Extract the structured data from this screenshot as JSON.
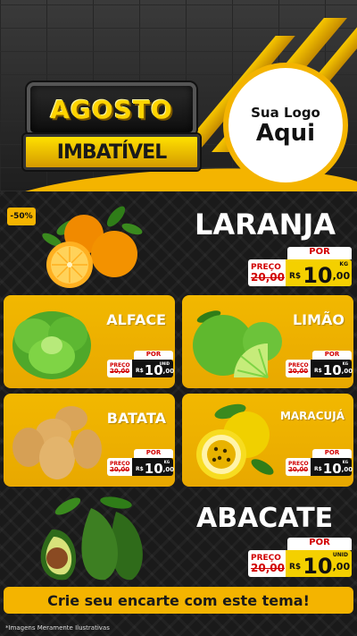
{
  "header": {
    "title_line1": "AGOSTO",
    "title_line2": "IMBATÍVEL",
    "logo_line1": "Sua Logo",
    "logo_line2": "Aqui"
  },
  "discount_badge": "-50%",
  "products": {
    "laranja": {
      "name": "LARANJA",
      "por": "POR",
      "preco_label": "PREÇO",
      "old": "20,00",
      "currency": "R$",
      "int": "10",
      "dec": ",00",
      "unit": "KG",
      "icon": "orange-image"
    },
    "alface": {
      "name": "ALFACE",
      "por": "POR",
      "preco_label": "PREÇO",
      "old": "20,00",
      "currency": "R$",
      "int": "10",
      "dec": ",00",
      "unit": "UNID",
      "icon": "lettuce-image"
    },
    "limao": {
      "name": "LIMÃO",
      "por": "POR",
      "preco_label": "PREÇO",
      "old": "20,00",
      "currency": "R$",
      "int": "10",
      "dec": ",00",
      "unit": "KG",
      "icon": "lime-image"
    },
    "batata": {
      "name": "BATATA",
      "por": "POR",
      "preco_label": "PREÇO",
      "old": "20,00",
      "currency": "R$",
      "int": "10",
      "dec": ",00",
      "unit": "KG",
      "icon": "potato-image"
    },
    "maracuja": {
      "name": "MARACUJÁ",
      "por": "POR",
      "preco_label": "PREÇO",
      "old": "20,00",
      "currency": "R$",
      "int": "10",
      "dec": ",00",
      "unit": "KG",
      "icon": "passionfruit-image"
    },
    "abacate": {
      "name": "ABACATE",
      "por": "POR",
      "preco_label": "PREÇO",
      "old": "20,00",
      "currency": "R$",
      "int": "10",
      "dec": ",00",
      "unit": "UNID",
      "icon": "avocado-image"
    }
  },
  "banner": "Crie seu encarte com este tema!",
  "disclaimer": "*Imagens Meramente Ilustrativas",
  "colors": {
    "accent": "#f4b400",
    "price_red": "#d10000",
    "dark": "#111111"
  }
}
